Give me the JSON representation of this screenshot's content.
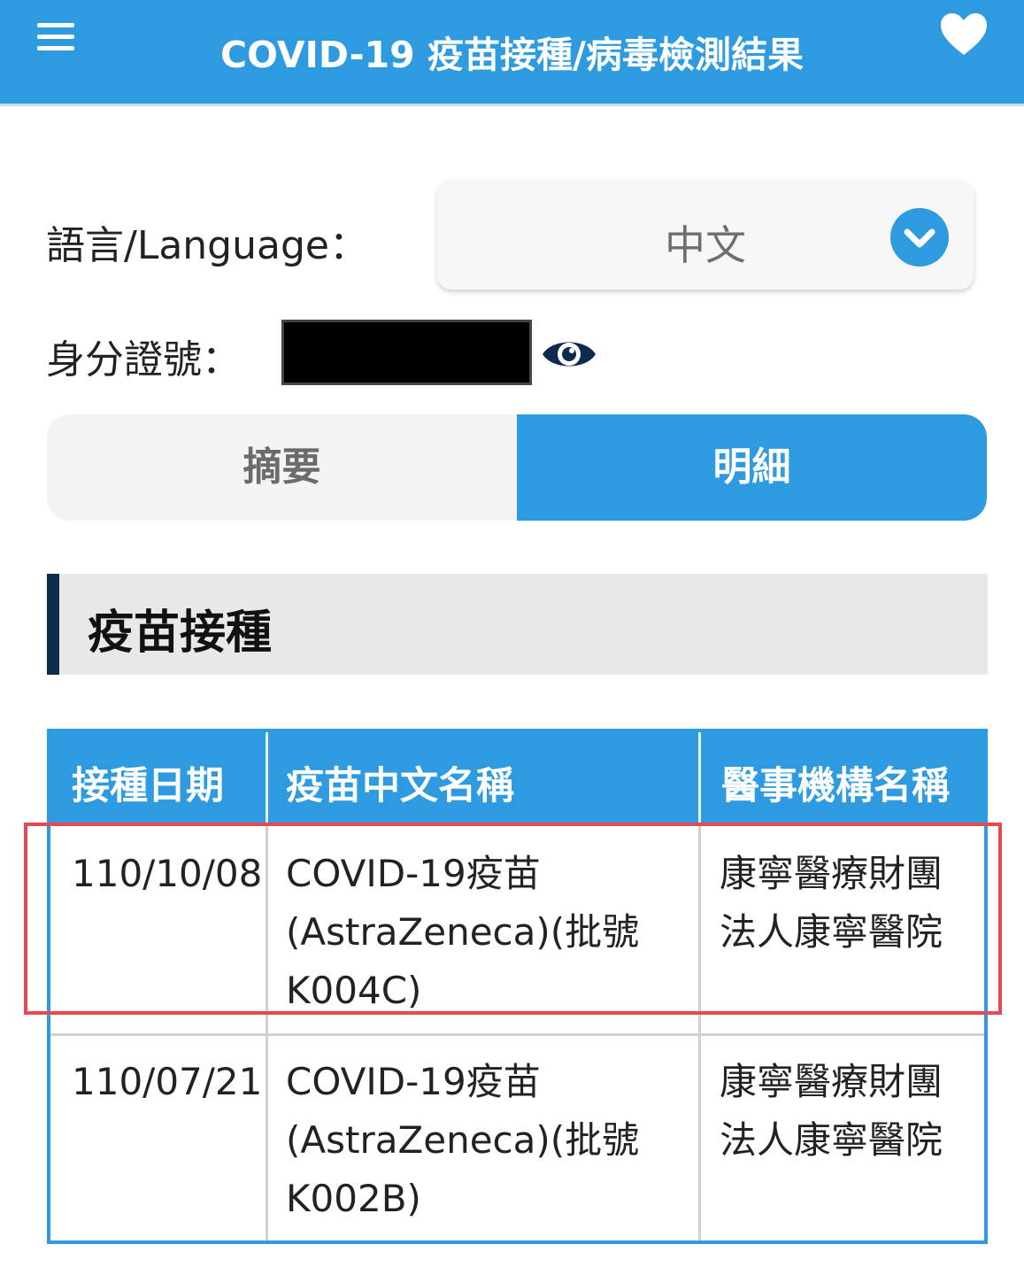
{
  "header": {
    "title": "COVID-19 疫苗接種/病毒檢測結果",
    "menu_icon": "menu-icon",
    "favorite_icon": "heart-icon"
  },
  "language": {
    "label": "語言/Language：",
    "selected": "中文",
    "dropdown_icon": "chevron-down-icon"
  },
  "id_field": {
    "label": "身分證號：",
    "value_state": "redacted",
    "toggle_icon": "eye-icon"
  },
  "tabs": [
    {
      "label": "摘要",
      "active": false
    },
    {
      "label": "明細",
      "active": true
    }
  ],
  "section": {
    "title": "疫苗接種"
  },
  "vaccine_table": {
    "columns": [
      "接種日期",
      "疫苗中文名稱",
      "醫事機構名稱"
    ],
    "rows": [
      {
        "date": "110/10/08",
        "vaccine_lines": [
          "COVID-19疫苗",
          "(AstraZeneca)(批號",
          "K004C)"
        ],
        "org_lines": [
          "康寧醫療財團",
          "法人康寧醫院"
        ],
        "highlighted": true
      },
      {
        "date": "110/07/21",
        "vaccine_lines": [
          "COVID-19疫苗",
          "(AstraZeneca)(批號",
          "K002B)"
        ],
        "org_lines": [
          "康寧醫療財團",
          "法人康寧醫院"
        ],
        "highlighted": false
      }
    ]
  },
  "colors": {
    "primary": "#2e9be0",
    "section_accent": "#0e2b4f",
    "highlight": "#e34a55"
  }
}
